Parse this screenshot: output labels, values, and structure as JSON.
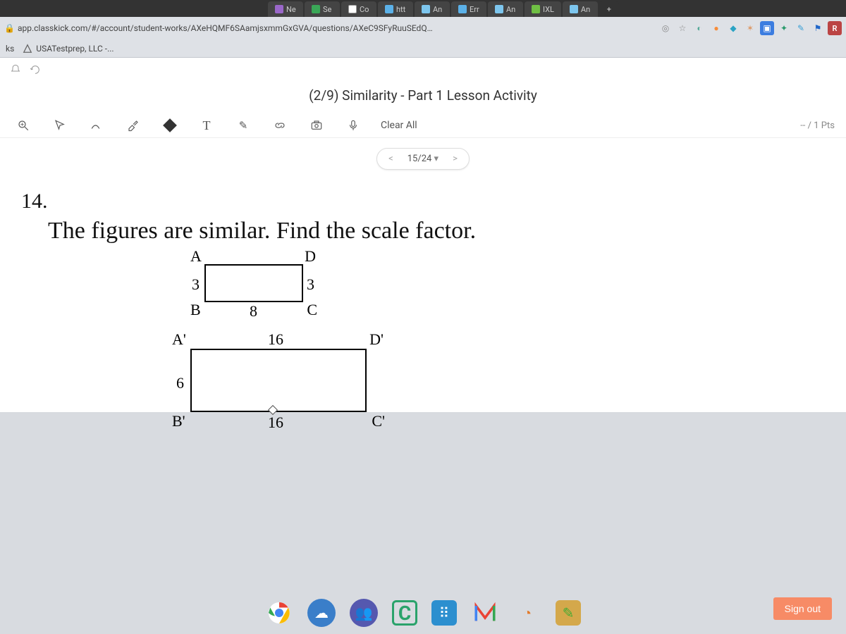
{
  "browser": {
    "tabs": [
      {
        "label": "Ne",
        "fav": "#9a67c9"
      },
      {
        "label": "Se",
        "fav": "#3aa757"
      },
      {
        "label": "Co",
        "fav": "#ffffff"
      },
      {
        "label": "htt",
        "fav": "#5bb1e8"
      },
      {
        "label": "An",
        "fav": "#7dc6ee"
      },
      {
        "label": "Err",
        "fav": "#5bb1e8"
      },
      {
        "label": "An",
        "fav": "#7dc6ee"
      },
      {
        "label": "IXL",
        "fav": "#6fbf44"
      },
      {
        "label": "An",
        "fav": "#7dc6ee"
      }
    ],
    "newtab": "+",
    "url": "app.classkick.com/#/account/student-works/AXeHQMF6SAamjsxmmGxGVA/questions/AXeC9SFyRuuSEdQ…",
    "extensions": [
      {
        "name": "location-icon",
        "color": "#888",
        "glyph": "◎"
      },
      {
        "name": "star-icon",
        "color": "#888",
        "glyph": "☆"
      },
      {
        "name": "shield-icon",
        "color": "#5a9",
        "glyph": "◐"
      },
      {
        "name": "orange-icon",
        "color": "#f78c3a",
        "glyph": "●"
      },
      {
        "name": "blue-icon",
        "color": "#2aa3c4",
        "glyph": "◆"
      },
      {
        "name": "puzzle-icon",
        "color": "#d96",
        "glyph": "✶"
      },
      {
        "name": "blue2-icon",
        "color": "#3c7de0",
        "glyph": "▣"
      },
      {
        "name": "green-icon",
        "color": "#2a9a6b",
        "glyph": "✦"
      },
      {
        "name": "pen-icon",
        "color": "#39a0d6",
        "glyph": "✎"
      },
      {
        "name": "flag-icon",
        "color": "#2067c9",
        "glyph": "⚑"
      },
      {
        "name": "r-icon",
        "color": "#b44",
        "glyph": "R"
      }
    ]
  },
  "bookmarks_bar": {
    "label_left": "ks",
    "items": [
      {
        "label": "USATestprep, LLC -..."
      }
    ]
  },
  "app": {
    "top_icons": [
      "notification-icon",
      "refresh-icon"
    ],
    "title": "(2/9) Similarity - Part 1 Lesson Activity",
    "toolbar": {
      "tool_names": [
        "zoom-icon",
        "pointer-icon",
        "draw-icon",
        "highlighter-icon",
        "color-icon"
      ],
      "text_label": "T",
      "pen_label": "✎",
      "link_label": "link-icon",
      "camera_label": "camera-icon",
      "mic_label": "mic-icon",
      "clear_all": "Clear All",
      "points": "-- / 1 Pts"
    },
    "pager": {
      "prev": "<",
      "value": "15/24",
      "next": ">"
    },
    "question": {
      "number": "14.",
      "text": "The figures are similar. Find the scale factor.",
      "fig1": {
        "A": "A",
        "B": "B",
        "C": "C",
        "D": "D",
        "left": "3",
        "right": "3",
        "bottom": "8"
      },
      "fig2": {
        "A": "A'",
        "B": "B'",
        "C": "C'",
        "D": "D'",
        "left": "6",
        "top": "16",
        "bottom": "16"
      }
    },
    "signout": "Sign out"
  },
  "taskbar_icons": [
    {
      "name": "chrome-icon",
      "color": "transparent",
      "glyph": "chrome"
    },
    {
      "name": "cloud-icon",
      "color": "#3a7ec9",
      "glyph": "☁"
    },
    {
      "name": "teams-icon",
      "color": "#5558af",
      "glyph": "👥"
    },
    {
      "name": "classkick-c-icon",
      "color": "#2aa36b",
      "glyph": "C"
    },
    {
      "name": "dots-icon",
      "color": "#2c8fcf",
      "glyph": "⠿"
    },
    {
      "name": "m-icon",
      "color": "transparent",
      "glyph": "m"
    },
    {
      "name": "orange-app-icon",
      "color": "#e27a2a",
      "glyph": "◔"
    },
    {
      "name": "brush-icon",
      "color": "#d4a84b",
      "glyph": "✎"
    }
  ]
}
